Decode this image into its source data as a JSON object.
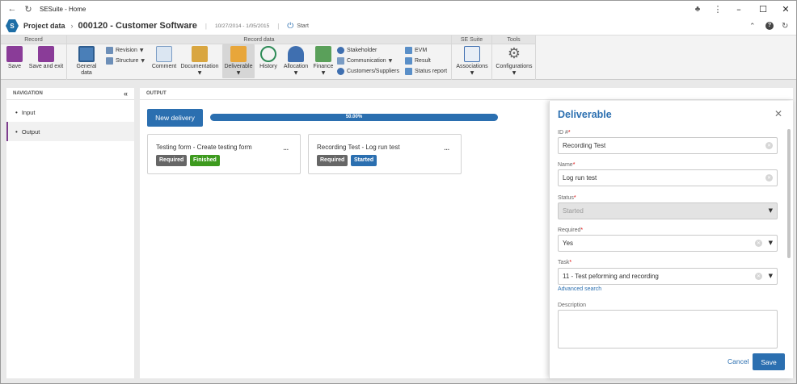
{
  "window": {
    "title": "SESuite - Home",
    "minimize": "–",
    "maximize": "☐",
    "close": "✕"
  },
  "appbar": {
    "section": "Project data",
    "record_title": "000120 - Customer Software",
    "separator": "|",
    "dates": "10/27/2014 - 1/05/2015",
    "status": "Start"
  },
  "ribbon": {
    "groups": {
      "record": "Record",
      "record_data": "Record data",
      "se_suite": "SE Suite",
      "tools": "Tools"
    },
    "save": "Save",
    "save_exit": "Save and exit",
    "general_data": "General data",
    "revision": "Revision",
    "structure": "Structure",
    "comment": "Comment",
    "documentation": "Documentation",
    "deliverable": "Deliverable",
    "history": "History",
    "allocation": "Allocation",
    "finance": "Finance",
    "stakeholder": "Stakeholder",
    "communication": "Communication",
    "customers_suppliers": "Customers/Suppliers",
    "evm": "EVM",
    "result": "Result",
    "status_report": "Status report",
    "associations": "Associations",
    "configurations": "Configurations"
  },
  "navigation": {
    "header": "NAVIGATION",
    "collapse": "«",
    "items": [
      {
        "label": "Input"
      },
      {
        "label": "Output"
      }
    ]
  },
  "output": {
    "header": "OUTPUT",
    "new_delivery": "New delivery",
    "progress": {
      "label": "50.00%",
      "value": 0.5
    },
    "cards": [
      {
        "title": "Testing form - Create testing form",
        "more": "...",
        "badges": [
          "Required",
          "Finished"
        ]
      },
      {
        "title": "Recording Test - Log run test",
        "more": "...",
        "badges": [
          "Required",
          "Started"
        ]
      }
    ]
  },
  "drawer": {
    "title": "Deliverable",
    "close": "✕",
    "id_label": "ID #",
    "id_value": "Recording Test",
    "name_label": "Name",
    "name_value": "Log run test",
    "status_label": "Status",
    "status_value": "Started",
    "required_label": "Required",
    "required_value": "Yes",
    "task_label": "Task",
    "task_value": "11 - Test peforming and recording",
    "advanced_search": "Advanced search",
    "description_label": "Description",
    "cancel": "Cancel",
    "save": "Save"
  },
  "colors": {
    "accent": "#2b6fb0",
    "finished": "#3d9a1e",
    "required": "#666666",
    "nav_selected": "#7e3e8e"
  }
}
